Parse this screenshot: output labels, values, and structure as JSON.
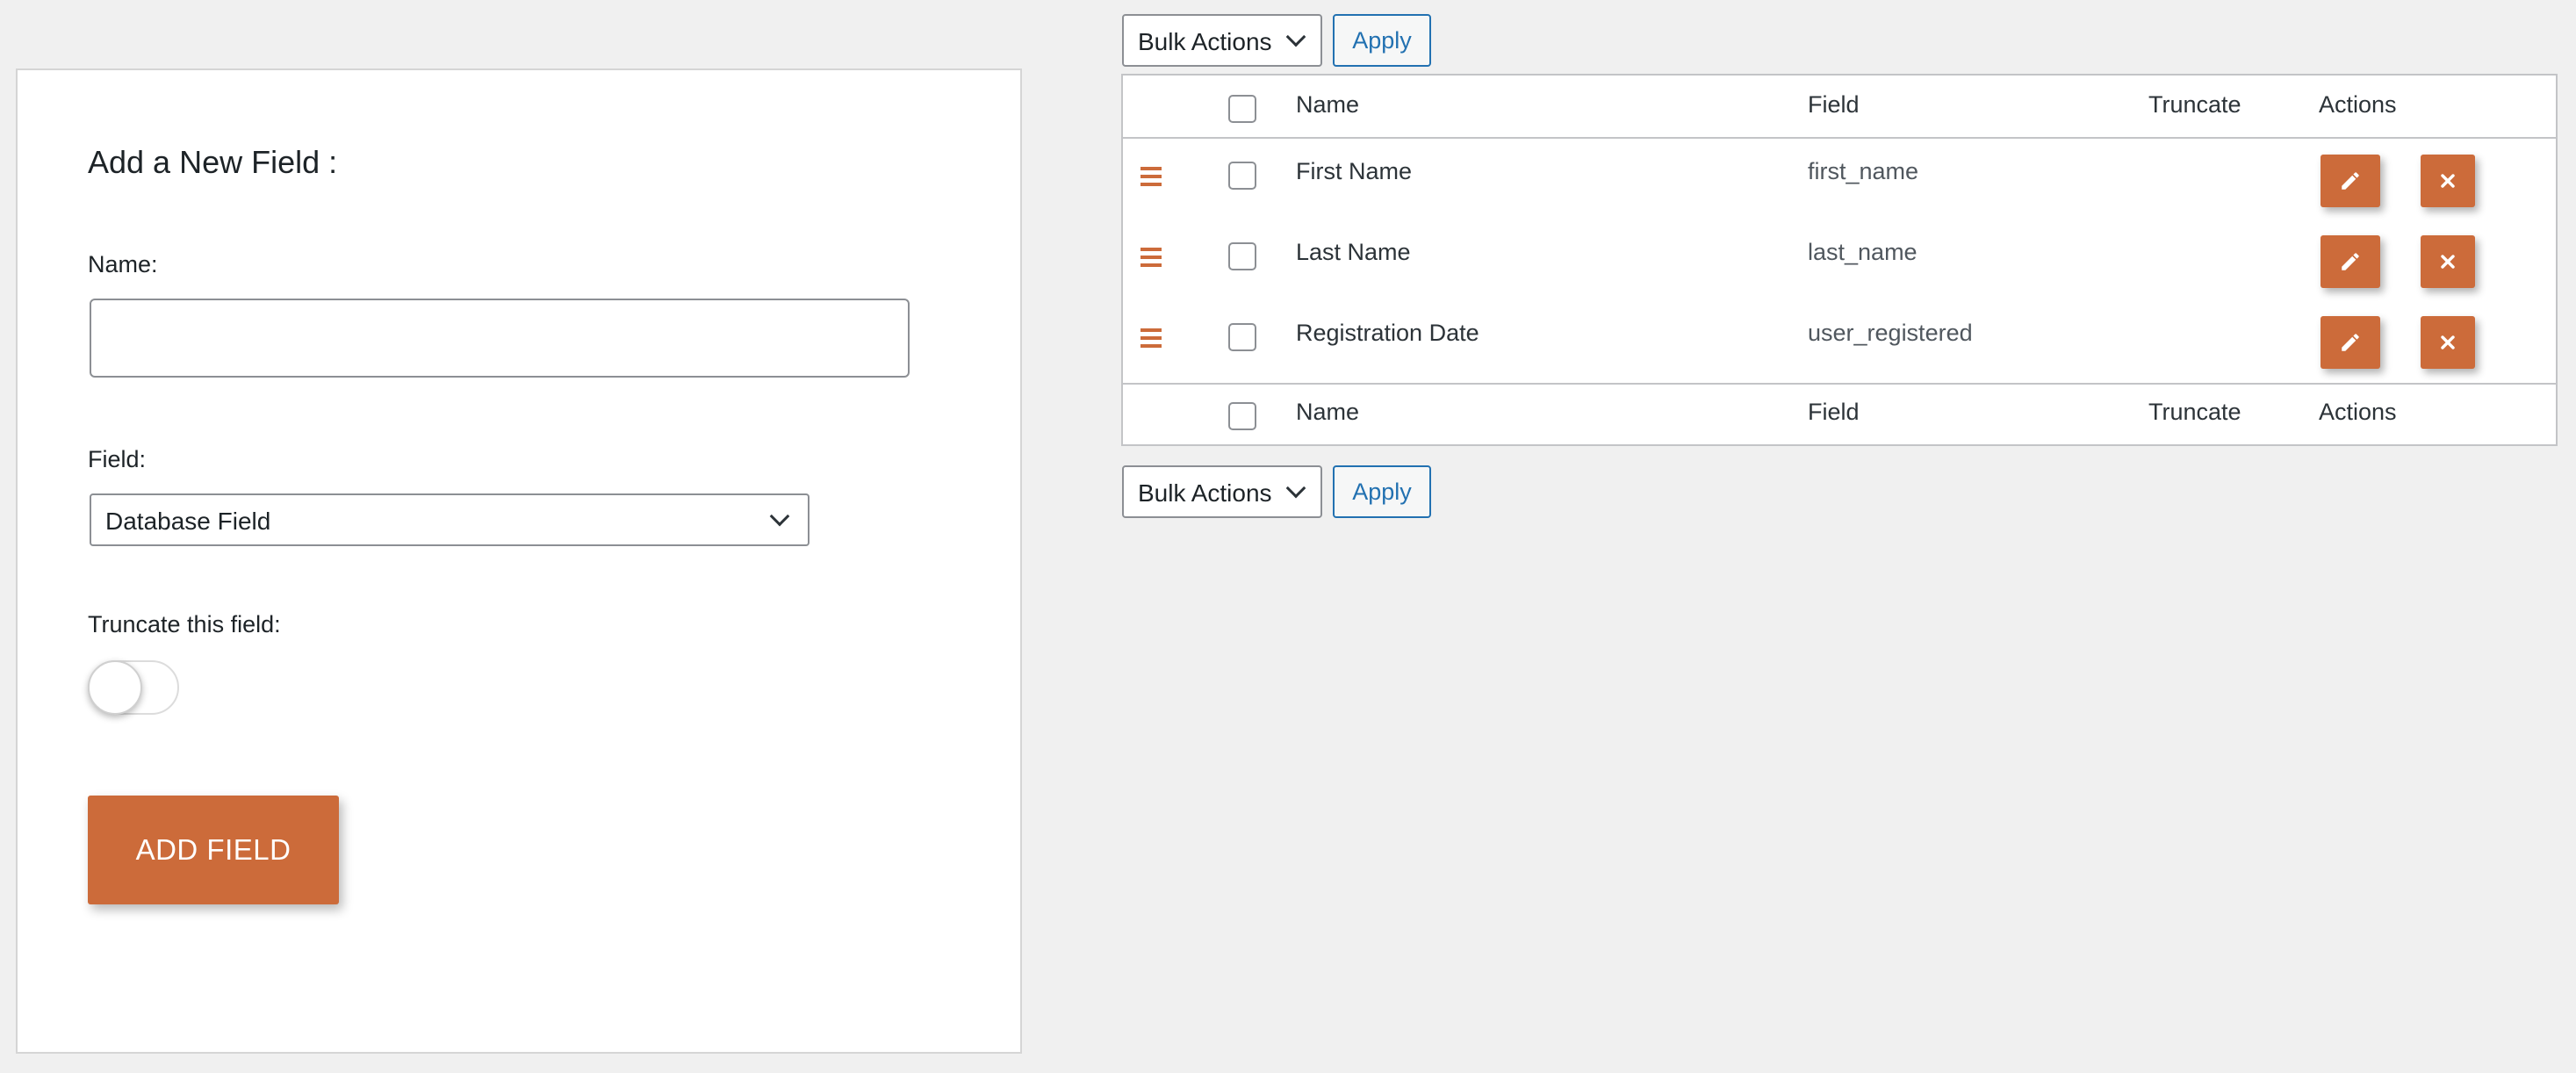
{
  "form": {
    "title": "Add a New Field :",
    "name_label": "Name:",
    "name_value": "",
    "field_label": "Field:",
    "field_selected": "Database Field",
    "truncate_label": "Truncate this field:",
    "truncate_on": false,
    "add_button": "ADD FIELD"
  },
  "bulk_top": {
    "label": "Bulk Actions",
    "apply": "Apply"
  },
  "bulk_bottom": {
    "label": "Bulk Actions",
    "apply": "Apply"
  },
  "table": {
    "columns": [
      "Name",
      "Field",
      "Truncate",
      "Actions"
    ],
    "rows": [
      {
        "name": "First Name",
        "field": "first_name",
        "truncate": ""
      },
      {
        "name": "Last Name",
        "field": "last_name",
        "truncate": ""
      },
      {
        "name": "Registration Date",
        "field": "user_registered",
        "truncate": ""
      }
    ]
  },
  "icons": {
    "drag": "drag-handle-icon",
    "edit": "pencil-icon",
    "delete": "close-icon",
    "dropdown": "chevron-down-icon"
  },
  "colors": {
    "accent": "#cc6b3a",
    "link": "#2271b1",
    "background": "#f0f0f0"
  }
}
